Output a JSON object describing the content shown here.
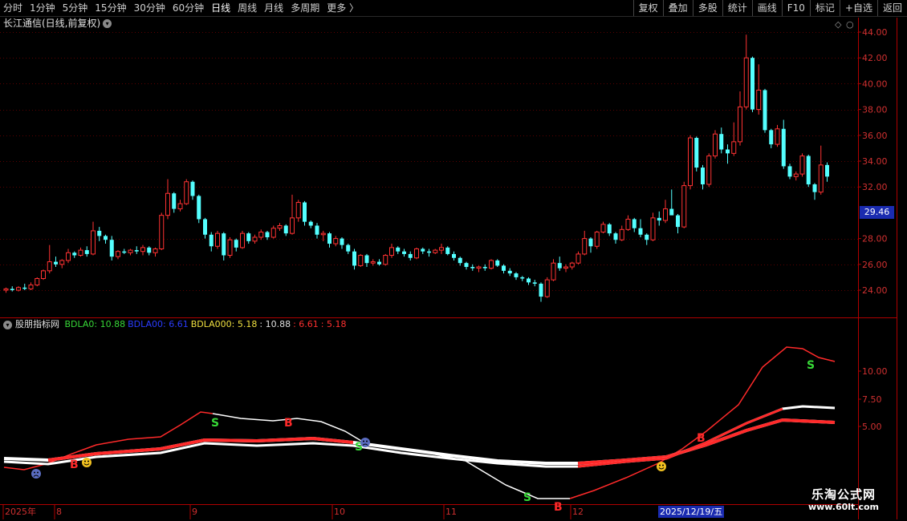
{
  "toolbar": {
    "left": [
      "分时",
      "1分钟",
      "5分钟",
      "15分钟",
      "30分钟",
      "60分钟",
      "日线",
      "周线",
      "月线",
      "多周期",
      "更多 〉"
    ],
    "active": "日线",
    "right": [
      "复权",
      "叠加",
      "多股",
      "统计",
      "画线",
      "F10",
      "标记",
      "+自选",
      "返回"
    ]
  },
  "chart_title": "长江通信(日线,前复权)",
  "indicator": {
    "name": "股朋指标网",
    "legend": [
      {
        "text": "BDLA0: 10.88",
        "color": "#37d837"
      },
      {
        "text": "BDLA00: 6.61",
        "color": "#2a3cff"
      },
      {
        "text": "BDLA000: 5.18",
        "color": "#f0e040"
      },
      {
        "text": ": 10.88",
        "color": "#e0e0e0"
      },
      {
        "text": ": 6.61",
        "color": "#ff3030"
      },
      {
        "text": ": 5.18",
        "color": "#ff3030"
      }
    ]
  },
  "price_axis": [
    "44.00",
    "42.00",
    "40.00",
    "38.00",
    "36.00",
    "34.00",
    "32.00",
    "28.00",
    "26.00",
    "24.00"
  ],
  "current_price": "29.46",
  "indicator_axis": [
    "10.00",
    "7.50",
    "5.00"
  ],
  "date_axis": [
    "2025年",
    "8",
    "9",
    "10",
    "11",
    "12"
  ],
  "selected_date": "2025/12/19/五",
  "signals": [
    "B",
    "S",
    "B",
    "S",
    "S",
    "B",
    "S",
    "B"
  ],
  "watermark": {
    "line1": "乐淘公式网",
    "line2": "www.60lt.com"
  },
  "colors": {
    "up": "#ff3232",
    "down": "#54ffff",
    "grid": "#5a0000",
    "axis": "#b00000"
  },
  "chart_data": {
    "type": "candlestick",
    "y_range": [
      23,
      44
    ],
    "candles": [
      [
        24.0,
        24.2,
        23.8,
        24.1
      ],
      [
        24.1,
        24.3,
        23.9,
        24.0
      ],
      [
        24.0,
        24.3,
        23.9,
        24.2
      ],
      [
        24.2,
        24.5,
        24.0,
        24.1
      ],
      [
        24.1,
        24.6,
        24.0,
        24.4
      ],
      [
        24.4,
        25.0,
        24.3,
        24.9
      ],
      [
        24.9,
        25.6,
        24.8,
        25.5
      ],
      [
        25.5,
        27.5,
        25.3,
        26.2
      ],
      [
        26.2,
        26.6,
        25.8,
        26.0
      ],
      [
        26.0,
        26.4,
        25.7,
        26.3
      ],
      [
        26.3,
        27.2,
        26.1,
        26.9
      ],
      [
        26.9,
        27.0,
        26.5,
        26.7
      ],
      [
        26.7,
        27.3,
        26.6,
        27.1
      ],
      [
        27.1,
        27.4,
        26.6,
        26.8
      ],
      [
        26.8,
        29.3,
        26.7,
        28.6
      ],
      [
        28.6,
        28.9,
        27.8,
        28.2
      ],
      [
        28.2,
        28.3,
        27.6,
        27.9
      ],
      [
        27.9,
        28.2,
        26.3,
        26.6
      ],
      [
        26.6,
        27.1,
        26.4,
        27.0
      ],
      [
        27.0,
        27.2,
        26.8,
        26.9
      ],
      [
        26.9,
        27.2,
        26.7,
        27.1
      ],
      [
        27.1,
        27.4,
        26.8,
        27.0
      ],
      [
        27.0,
        27.5,
        26.7,
        27.3
      ],
      [
        27.3,
        27.4,
        26.7,
        26.9
      ],
      [
        26.9,
        27.3,
        26.6,
        27.2
      ],
      [
        27.2,
        30.0,
        27.1,
        29.8
      ],
      [
        29.8,
        32.6,
        29.5,
        31.5
      ],
      [
        31.5,
        31.6,
        30.0,
        30.3
      ],
      [
        30.3,
        31.0,
        30.1,
        30.7
      ],
      [
        30.7,
        32.6,
        30.6,
        32.4
      ],
      [
        32.4,
        32.5,
        31.0,
        31.3
      ],
      [
        31.3,
        31.4,
        29.2,
        29.5
      ],
      [
        29.5,
        29.6,
        28.0,
        28.3
      ],
      [
        28.3,
        28.5,
        27.0,
        27.4
      ],
      [
        27.4,
        28.6,
        27.2,
        28.4
      ],
      [
        28.4,
        28.5,
        26.3,
        26.7
      ],
      [
        26.7,
        28.1,
        26.5,
        27.9
      ],
      [
        27.9,
        28.0,
        27.0,
        27.3
      ],
      [
        27.3,
        28.6,
        27.2,
        28.4
      ],
      [
        28.4,
        28.5,
        27.6,
        27.8
      ],
      [
        27.8,
        28.3,
        27.6,
        28.1
      ],
      [
        28.1,
        28.7,
        27.9,
        28.5
      ],
      [
        28.5,
        28.6,
        27.9,
        28.1
      ],
      [
        28.1,
        29.0,
        28.0,
        28.8
      ],
      [
        28.8,
        29.2,
        28.6,
        29.0
      ],
      [
        29.0,
        29.1,
        28.2,
        28.4
      ],
      [
        28.4,
        31.4,
        28.3,
        29.6
      ],
      [
        29.6,
        31.0,
        29.3,
        30.8
      ],
      [
        30.8,
        30.9,
        29.0,
        29.3
      ],
      [
        29.3,
        29.4,
        28.8,
        29.0
      ],
      [
        29.0,
        29.2,
        28.0,
        28.3
      ],
      [
        28.3,
        28.6,
        27.8,
        28.4
      ],
      [
        28.4,
        28.5,
        27.3,
        27.6
      ],
      [
        27.6,
        28.2,
        27.4,
        28.0
      ],
      [
        28.0,
        28.1,
        27.2,
        27.5
      ],
      [
        27.5,
        27.6,
        26.8,
        27.0
      ],
      [
        27.0,
        27.2,
        25.6,
        25.9
      ],
      [
        25.9,
        26.8,
        25.8,
        26.7
      ],
      [
        26.7,
        26.8,
        25.8,
        26.1
      ],
      [
        26.1,
        26.4,
        25.9,
        26.2
      ],
      [
        26.2,
        26.4,
        25.9,
        26.0
      ],
      [
        26.0,
        26.8,
        25.9,
        26.7
      ],
      [
        26.7,
        27.6,
        26.5,
        27.3
      ],
      [
        27.3,
        27.4,
        26.8,
        27.0
      ],
      [
        27.0,
        27.2,
        26.6,
        26.8
      ],
      [
        26.8,
        27.0,
        26.3,
        26.5
      ],
      [
        26.5,
        27.3,
        26.4,
        27.2
      ],
      [
        27.2,
        27.3,
        26.8,
        27.0
      ],
      [
        27.0,
        27.2,
        26.6,
        26.9
      ],
      [
        26.9,
        27.2,
        26.8,
        27.1
      ],
      [
        27.1,
        27.6,
        26.8,
        27.3
      ],
      [
        27.3,
        27.4,
        26.7,
        26.8
      ],
      [
        26.8,
        27.0,
        26.3,
        26.5
      ],
      [
        26.5,
        26.6,
        25.9,
        26.1
      ],
      [
        26.1,
        26.2,
        25.6,
        25.8
      ],
      [
        25.8,
        26.0,
        25.5,
        25.7
      ],
      [
        25.7,
        25.9,
        25.4,
        25.8
      ],
      [
        25.8,
        26.0,
        25.5,
        25.7
      ],
      [
        25.7,
        26.4,
        25.6,
        26.3
      ],
      [
        26.3,
        26.4,
        25.8,
        25.9
      ],
      [
        25.9,
        26.0,
        25.3,
        25.5
      ],
      [
        25.5,
        25.7,
        25.1,
        25.3
      ],
      [
        25.3,
        25.4,
        24.8,
        25.0
      ],
      [
        25.0,
        25.1,
        24.7,
        24.9
      ],
      [
        24.9,
        25.0,
        24.4,
        24.6
      ],
      [
        24.6,
        24.8,
        24.3,
        24.5
      ],
      [
        24.5,
        24.6,
        23.1,
        23.5
      ],
      [
        23.5,
        25.0,
        23.4,
        24.8
      ],
      [
        24.8,
        26.4,
        24.7,
        26.1
      ],
      [
        26.1,
        26.6,
        25.5,
        25.7
      ],
      [
        25.7,
        26.0,
        25.4,
        25.8
      ],
      [
        25.8,
        26.2,
        25.6,
        26.1
      ],
      [
        26.1,
        27.0,
        26.0,
        26.8
      ],
      [
        26.8,
        28.6,
        26.7,
        28.0
      ],
      [
        28.0,
        28.1,
        26.9,
        27.4
      ],
      [
        27.4,
        28.6,
        27.2,
        28.5
      ],
      [
        28.5,
        29.3,
        28.4,
        29.1
      ],
      [
        29.1,
        29.2,
        28.2,
        28.4
      ],
      [
        28.4,
        28.5,
        27.6,
        27.9
      ],
      [
        27.9,
        29.0,
        27.8,
        28.7
      ],
      [
        28.7,
        29.8,
        28.6,
        29.5
      ],
      [
        29.5,
        29.6,
        28.5,
        28.8
      ],
      [
        28.8,
        29.5,
        28.1,
        28.3
      ],
      [
        28.3,
        28.4,
        27.5,
        27.9
      ],
      [
        27.9,
        30.0,
        27.8,
        29.6
      ],
      [
        29.6,
        30.1,
        29.0,
        29.4
      ],
      [
        29.4,
        31.0,
        29.2,
        30.3
      ],
      [
        30.3,
        31.8,
        29.9,
        29.8
      ],
      [
        29.8,
        29.9,
        28.4,
        28.9
      ],
      [
        28.9,
        32.4,
        28.8,
        32.1
      ],
      [
        32.1,
        36.0,
        31.8,
        35.8
      ],
      [
        35.8,
        35.9,
        33.2,
        33.5
      ],
      [
        33.5,
        33.7,
        31.8,
        32.2
      ],
      [
        32.2,
        34.6,
        32.0,
        34.4
      ],
      [
        34.4,
        36.4,
        34.2,
        36.1
      ],
      [
        36.1,
        36.6,
        34.6,
        34.9
      ],
      [
        34.9,
        35.3,
        33.8,
        34.6
      ],
      [
        34.6,
        37.0,
        34.4,
        35.5
      ],
      [
        35.5,
        39.4,
        35.2,
        38.2
      ],
      [
        38.2,
        43.8,
        38.0,
        42.0
      ],
      [
        42.0,
        42.1,
        37.8,
        38.0
      ],
      [
        38.0,
        41.5,
        37.6,
        39.5
      ],
      [
        39.5,
        39.6,
        36.2,
        36.4
      ],
      [
        36.4,
        36.5,
        35.0,
        35.3
      ],
      [
        35.3,
        36.8,
        35.1,
        36.5
      ],
      [
        36.5,
        37.2,
        33.4,
        33.6
      ],
      [
        33.6,
        33.8,
        32.6,
        32.8
      ],
      [
        32.8,
        33.2,
        32.5,
        33.0
      ],
      [
        33.0,
        34.6,
        32.8,
        34.4
      ],
      [
        34.4,
        34.5,
        32.0,
        32.2
      ],
      [
        32.2,
        32.3,
        31.0,
        31.6
      ],
      [
        31.6,
        35.2,
        31.4,
        33.7
      ],
      [
        33.7,
        33.9,
        32.4,
        32.8
      ]
    ],
    "y_axis_ticks": [
      24,
      26,
      28,
      32,
      34,
      36,
      38,
      40,
      42,
      44
    ],
    "indicator_y_ticks": [
      5.0,
      7.5,
      10.0
    ]
  }
}
